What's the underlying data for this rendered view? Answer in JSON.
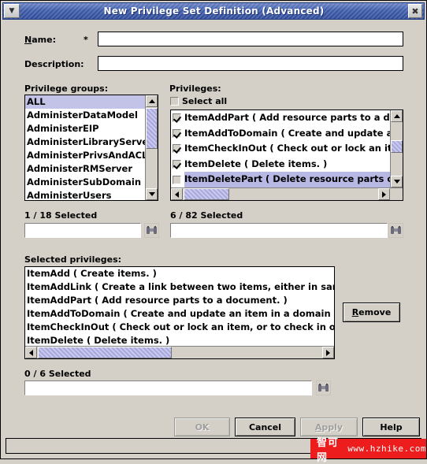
{
  "window": {
    "title": "New Privilege Set Definition (Advanced)",
    "menu_icon": "chevron-down-icon",
    "close_icon": "close-icon",
    "close_glyph": "✖",
    "menu_glyph": "▼",
    "titlebar_color": "#3d5aa8",
    "face_color": "#d4d0c8",
    "selection_color": "#b8b8e4"
  },
  "form": {
    "name_label": "Name:",
    "name_mnemonic": "N",
    "name_required_marker": "*",
    "name_value": "",
    "name_placeholder": "",
    "description_label": "Description:",
    "description_value": "",
    "description_placeholder": ""
  },
  "groups": {
    "label": "Privilege groups:",
    "items": [
      {
        "label": "ALL",
        "selected": true
      },
      {
        "label": "AdministerDataModel",
        "selected": false
      },
      {
        "label": "AdministerEIP",
        "selected": false
      },
      {
        "label": "AdministerLibraryServer",
        "selected": false
      },
      {
        "label": "AdministerPrivsAndACL",
        "selected": false
      },
      {
        "label": "AdministerRMServer",
        "selected": false
      },
      {
        "label": "AdministerSubDomain",
        "selected": false
      },
      {
        "label": "AdministerUsers",
        "selected": false
      }
    ],
    "count_text": "1 / 18 Selected",
    "filter_value": "",
    "filter_placeholder": "",
    "find_icon": "binoculars-icon"
  },
  "privileges": {
    "label": "Privileges:",
    "select_all_label": "Select all",
    "select_all_checked": false,
    "items": [
      {
        "label": "ItemAddPart ( Add resource parts to a doc",
        "checked": true,
        "selected": false
      },
      {
        "label": "ItemAddToDomain ( Create and update an",
        "checked": true,
        "selected": false
      },
      {
        "label": "ItemCheckInOut ( Check out or lock an ite",
        "checked": true,
        "selected": false
      },
      {
        "label": "ItemDelete ( Delete items. )",
        "checked": true,
        "selected": false
      },
      {
        "label": "ItemDeletePart ( Delete resource parts of a",
        "checked": false,
        "selected": true
      }
    ],
    "count_text": "6 / 82 Selected",
    "filter_value": "",
    "filter_placeholder": "",
    "find_icon": "binoculars-icon"
  },
  "selected_privileges": {
    "label": "Selected privileges:",
    "items": [
      "ItemAdd ( Create items. )",
      "ItemAddLink ( Create a link between two items, either in same",
      "ItemAddPart ( Add resource parts to a document. )",
      "ItemAddToDomain ( Create and update an item in a domain of",
      "ItemCheckInOut ( Check out or lock an item, or to check in or",
      "ItemDelete ( Delete items. )"
    ],
    "count_text": "0 / 6 Selected",
    "filter_value": "",
    "filter_placeholder": "",
    "find_icon": "binoculars-icon",
    "remove_label": "Remove",
    "remove_mnemonic": "R"
  },
  "buttons": {
    "ok": {
      "label": "OK",
      "enabled": false
    },
    "cancel": {
      "label": "Cancel",
      "enabled": true
    },
    "apply": {
      "label": "Apply",
      "mnemonic": "A",
      "enabled": false
    },
    "help": {
      "label": "Help",
      "enabled": true
    }
  },
  "statusbar": {
    "text": ""
  },
  "watermark": {
    "cn": "智可网",
    "url": "www.hzhike.com",
    "color": "#ee1d1d"
  }
}
